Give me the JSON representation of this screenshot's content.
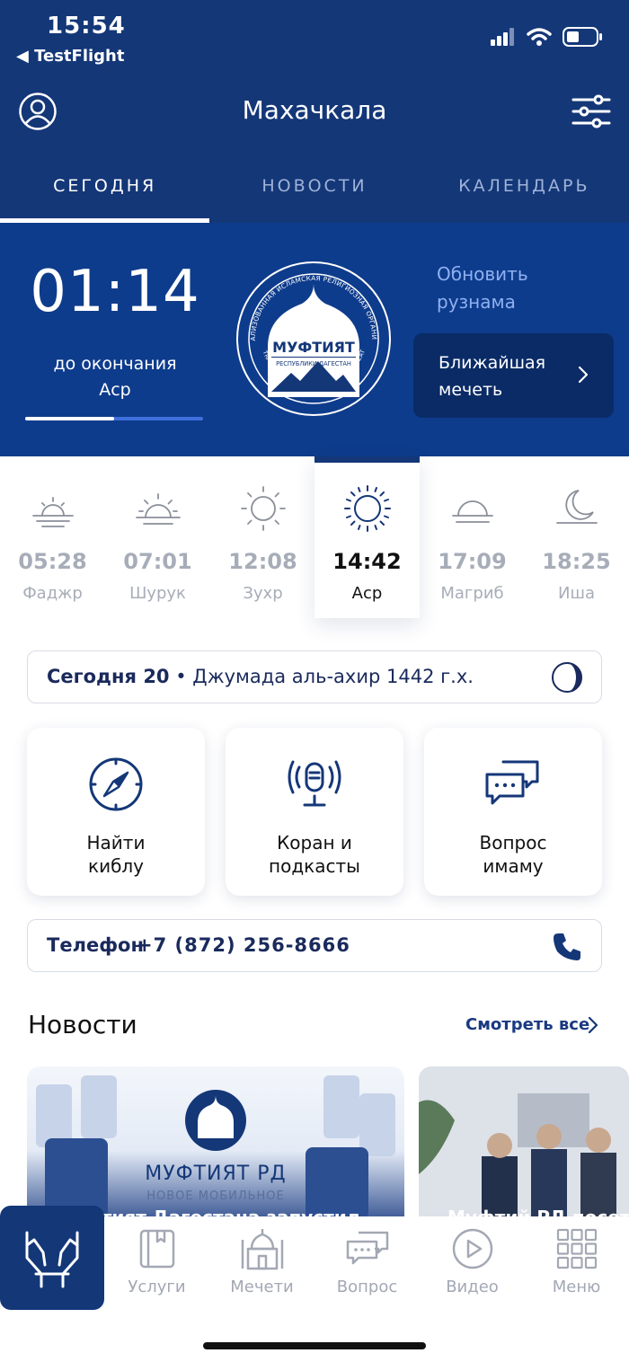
{
  "status_bar": {
    "time": "15:54",
    "back_label": "◀ TestFlight"
  },
  "header": {
    "title": "Махачкала"
  },
  "tabs": [
    {
      "label": "СЕГОДНЯ",
      "active": true
    },
    {
      "label": "НОВОСТИ",
      "active": false
    },
    {
      "label": "КАЛЕНДАРЬ",
      "active": false
    }
  ],
  "hero": {
    "countdown": "01:14",
    "countdown_label_line1": "до окончания",
    "countdown_label_line2": "Аср",
    "progress": 0.5,
    "refresh_line1": "Обновить",
    "refresh_line2": "рузнама",
    "nearest_line1": "Ближайшая",
    "nearest_line2": "мечеть",
    "logo": {
      "arc_top": "ЦЕНТРАЛИЗОВАННАЯ ИСЛАМСКАЯ РЕЛИГИОЗНАЯ ОРГАНИЗАЦИЯ",
      "arc_bottom": "CENTRALIZED ISLAMIC RELIGIOUS ORGANIZATION",
      "name": "МУФТИЯТ",
      "subtitle": "РЕСПУБЛИКИ ДАГЕСТАН"
    }
  },
  "prayers": [
    {
      "time": "05:28",
      "name": "Фаджр",
      "icon": "sunrise-icon",
      "active": false
    },
    {
      "time": "07:01",
      "name": "Шурук",
      "icon": "sunrise-full-icon",
      "active": false
    },
    {
      "time": "12:08",
      "name": "Зухр",
      "icon": "sun-icon",
      "active": false
    },
    {
      "time": "14:42",
      "name": "Аср",
      "icon": "sun-icon",
      "active": true
    },
    {
      "time": "17:09",
      "name": "Магриб",
      "icon": "sunset-icon",
      "active": false
    },
    {
      "time": "18:25",
      "name": "Иша",
      "icon": "moon-icon",
      "active": false
    }
  ],
  "date_bar": {
    "today_label": "Сегодня 20",
    "date_rest": " • Джумада аль-ахир 1442 г.х."
  },
  "cards": [
    {
      "line1": "Найти",
      "line2": "киблу",
      "icon": "compass-icon"
    },
    {
      "line1": "Коран и",
      "line2": "подкасты",
      "icon": "microphone-icon"
    },
    {
      "line1": "Вопрос",
      "line2": "имаму",
      "icon": "chat-icon"
    }
  ],
  "phone": {
    "label": "Телефон",
    "number": "+7 (872) 256-8666"
  },
  "news": {
    "title": "Новости",
    "see_all": "Смотреть все",
    "items": [
      {
        "brand": "МУФТИЯТ РД",
        "sub": "НОВОЕ МОБИЛЬНОЕ",
        "caption": "Муфтият Дагестана запустил"
      },
      {
        "caption": "Муфтий РД посетил"
      }
    ]
  },
  "tabbar": [
    {
      "label": "Услуги",
      "icon": "book-icon"
    },
    {
      "label": "Мечети",
      "icon": "mosque-icon"
    },
    {
      "label": "Вопрос",
      "icon": "chat-icon"
    },
    {
      "label": "Видео",
      "icon": "play-icon"
    },
    {
      "label": "Меню",
      "icon": "grid-icon"
    }
  ],
  "colors": {
    "primary": "#143778",
    "hero": "#0e3c8c",
    "accent": "#3e6fdc",
    "muted": "#a7adb8"
  }
}
